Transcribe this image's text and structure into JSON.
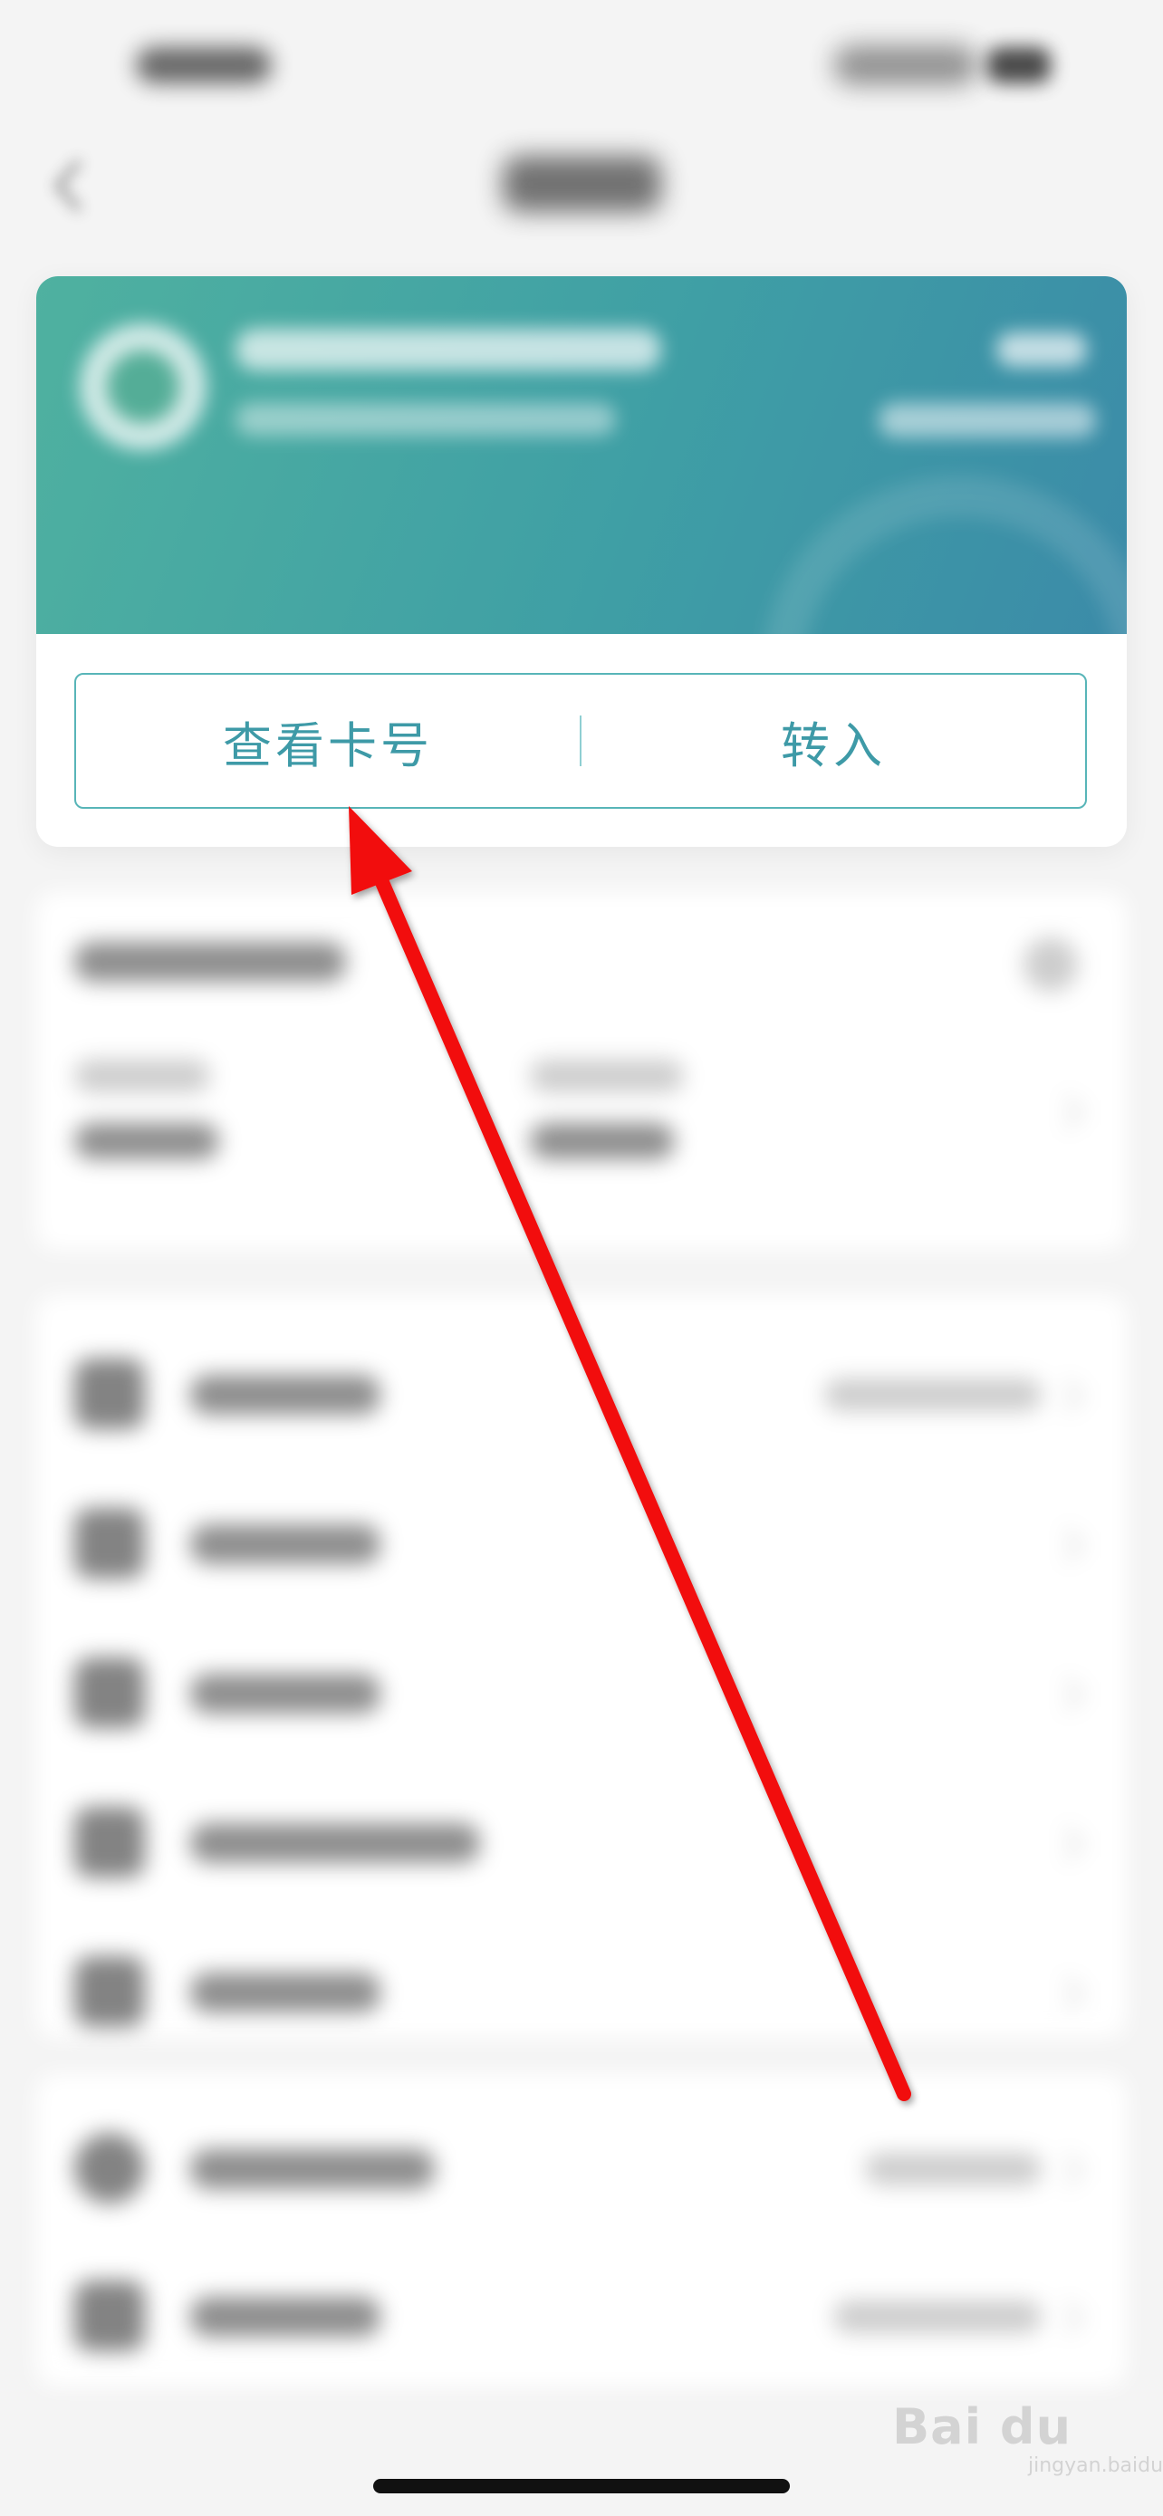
{
  "card": {
    "actions": [
      {
        "label": "查看卡号"
      },
      {
        "label": "转入"
      }
    ],
    "accent_color": "#3e9aa7",
    "header_gradient": [
      "#4fb1a0",
      "#3b8ba8"
    ]
  },
  "annotation": {
    "color": "#f20a0a"
  },
  "watermark": {
    "brand": "Bai du",
    "sub": "jingyan.baidu.com"
  }
}
